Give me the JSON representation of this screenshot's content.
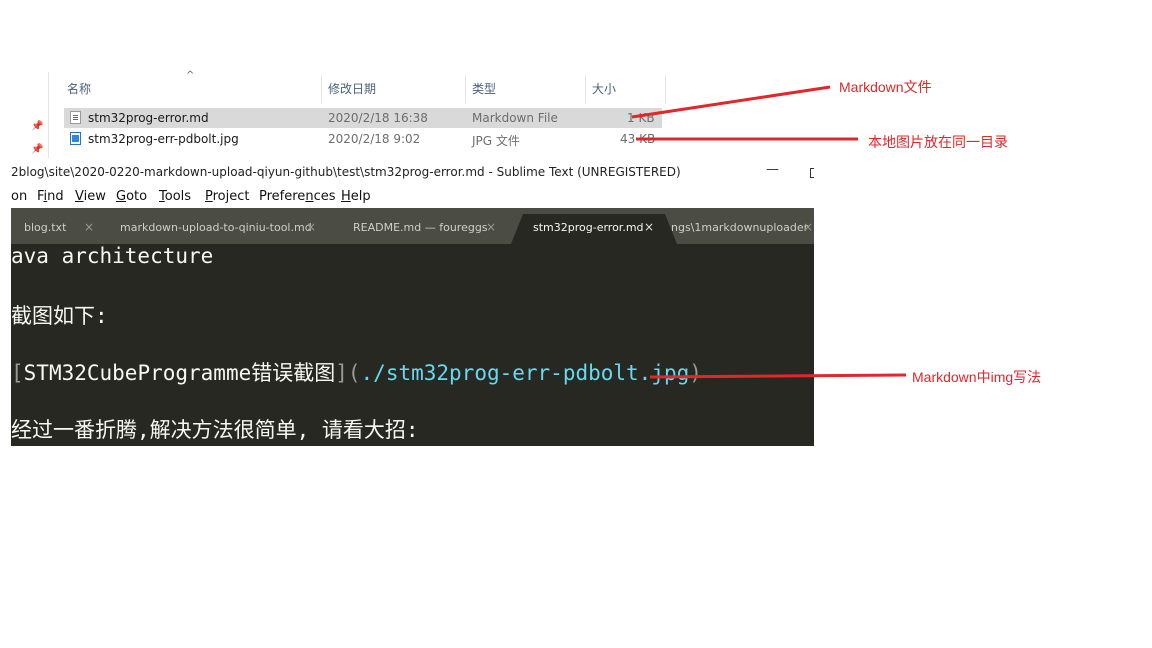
{
  "explorer": {
    "columns": [
      "名称",
      "修改日期",
      "类型",
      "大小"
    ],
    "sort_indicator": "^",
    "files": [
      {
        "name": "stm32prog-error.md",
        "modified": "2020/2/18 16:38",
        "type": "Markdown File",
        "size": "1 KB",
        "icon": "markdown-file-icon",
        "selected": true
      },
      {
        "name": "stm32prog-err-pdbolt.jpg",
        "modified": "2020/2/18 9:02",
        "type": "JPG 文件",
        "size": "43 KB",
        "icon": "jpg-file-icon",
        "selected": false
      }
    ]
  },
  "sublime": {
    "title": "2blog\\site\\2020-0220-markdown-upload-qiyun-github\\test\\stm32prog-error.md - Sublime Text (UNREGISTERED)",
    "window_controls": {
      "minimize": "—"
    },
    "menu": [
      "on",
      "Find",
      "View",
      "Goto",
      "Tools",
      "Project",
      "Preferences",
      "Help"
    ],
    "menu_mnemonics": [
      "",
      "i",
      "V",
      "G",
      "T",
      "P",
      "n",
      "H"
    ],
    "tabs": [
      {
        "label": "blog.txt",
        "active": false
      },
      {
        "label": "markdown-upload-to-qiniu-tool.md",
        "active": false
      },
      {
        "label": "README.md — foureggs",
        "active": false
      },
      {
        "label": "stm32prog-error.md",
        "active": true
      },
      {
        "label": "ngs\\1markdownuploader",
        "active": false
      }
    ],
    "tab_close_glyph": "×",
    "editor": {
      "line1": "ava architecture",
      "line2": "截图如下:",
      "line3_open": "[",
      "line3_text": "STM32CubeProgramme错误截图",
      "line3_mid": "](",
      "line3_url": "./stm32prog-err-pdbolt.jpg",
      "line3_close": ")",
      "line4": "经过一番折腾,解决方法很简单, 请看大招:"
    }
  },
  "annotations": {
    "color": "#e3262a",
    "markdown_file": "Markdown文件",
    "same_dir": "本地图片放在同一目录",
    "img_syntax": "Markdown中img写法"
  }
}
